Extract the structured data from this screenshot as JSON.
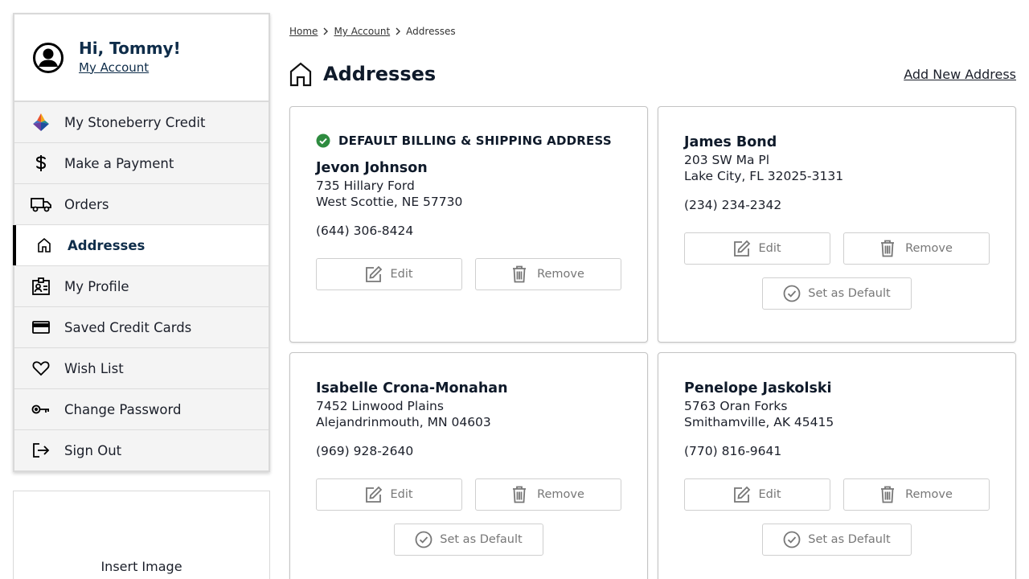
{
  "sidebar": {
    "greeting": "Hi, Tommy!",
    "account_link": "My Account",
    "items": [
      {
        "label": "My Stoneberry Credit",
        "icon": "stoneberry-logo-icon"
      },
      {
        "label": "Make a Payment",
        "icon": "dollar-icon"
      },
      {
        "label": "Orders",
        "icon": "truck-icon"
      },
      {
        "label": "Addresses",
        "icon": "home-icon",
        "active": true
      },
      {
        "label": "My Profile",
        "icon": "profile-badge-icon"
      },
      {
        "label": "Saved Credit Cards",
        "icon": "credit-card-icon"
      },
      {
        "label": "Wish List",
        "icon": "heart-icon"
      },
      {
        "label": "Change Password",
        "icon": "key-icon"
      },
      {
        "label": "Sign Out",
        "icon": "sign-out-icon"
      }
    ],
    "insert_image": "Insert Image"
  },
  "breadcrumb": {
    "home": "Home",
    "my_account": "My Account",
    "current": "Addresses"
  },
  "page": {
    "title": "Addresses",
    "add_new": "Add New Address"
  },
  "buttons": {
    "edit": "Edit",
    "remove": "Remove",
    "set_default": "Set as Default"
  },
  "addresses": [
    {
      "default_label": "DEFAULT BILLING & SHIPPING ADDRESS",
      "name": "Jevon Johnson",
      "street": "735 Hillary Ford",
      "city": "West Scottie, NE 57730",
      "phone": "(644) 306-8424"
    },
    {
      "name": "James Bond",
      "street": "203 SW Ma Pl",
      "city": "Lake City, FL 32025-3131",
      "phone": "(234) 234-2342"
    },
    {
      "name": "Isabelle Crona-Monahan",
      "street": "7452 Linwood Plains",
      "city": "Alejandrinmouth, MN 04603",
      "phone": "(969) 928-2640"
    },
    {
      "name": "Penelope Jaskolski",
      "street": "5763 Oran Forks",
      "city": "Smithamville, AK 45415",
      "phone": "(770) 816-9641"
    }
  ],
  "colors": {
    "brand_navy": "#0f2d4a",
    "default_check": "#2e8b3f",
    "active_bar": "#000000"
  }
}
